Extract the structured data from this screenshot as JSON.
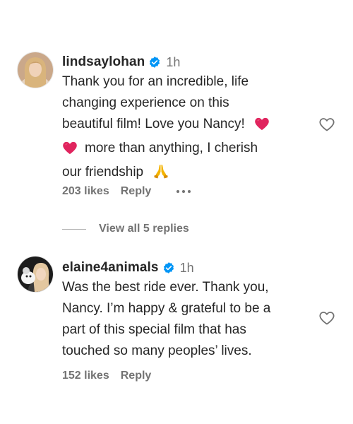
{
  "comments": [
    {
      "username": "lindsaylohan",
      "verified": true,
      "timestamp": "1h",
      "lines": [
        "Thank you for an incredible, life",
        "changing experience on this",
        "beautiful film! Love you Nancy!",
        "more than anything, I cherish",
        "our friendship"
      ],
      "emojis": [
        "red-heart",
        "red-heart",
        "folded-hands"
      ],
      "likes": "203 likes",
      "reply": "Reply",
      "view_replies": "View all 5 replies"
    },
    {
      "username": "elaine4animals",
      "verified": true,
      "timestamp": "1h",
      "lines": [
        "Was the best ride ever. Thank you,",
        "Nancy. I’m happy & grateful to be a",
        "part of this special film that has",
        "touched so many peoples’ lives."
      ],
      "likes": "152 likes",
      "reply": "Reply"
    }
  ],
  "colors": {
    "text": "#262626",
    "secondary": "#737373",
    "verified": "#0095f6",
    "heart_emoji": "#e0245e"
  }
}
